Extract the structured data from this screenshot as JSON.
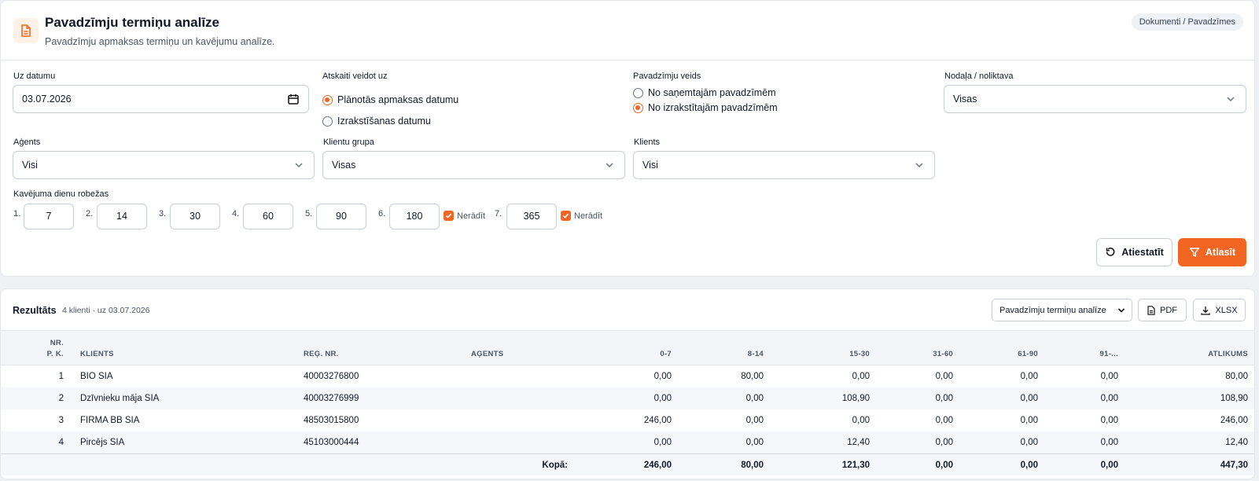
{
  "header": {
    "title": "Pavadzīmju termiņu analīze",
    "subtitle": "Pavadzīmju apmaksas termiņu un kavējumu analīze.",
    "breadcrumb": "Dokumenti / Pavadzīmes"
  },
  "filters": {
    "date_label": "Uz datumu",
    "date_value": "03.07.2026",
    "report_basis_label": "Atskaiti veidot uz",
    "report_basis_options": [
      "Plānotās apmaksas datumu",
      "Izrakstīšanas datumu"
    ],
    "report_basis_selected": 0,
    "invoice_type_label": "Pavadzīmju veids",
    "invoice_type_options": [
      "No saņemtajām pavadzīmēm",
      "No izrakstītajām pavadzīmēm"
    ],
    "invoice_type_selected": 1,
    "department_label": "Nodaļa / noliktava",
    "department_value": "Visas",
    "agent_label": "Aģents",
    "agent_value": "Visi",
    "client_group_label": "Klientu grupa",
    "client_group_value": "Visas",
    "client_label": "Klients",
    "client_value": "Visi",
    "thresholds_label": "Kavējuma dienu robežas",
    "thresholds": [
      {
        "num": "1.",
        "value": "7"
      },
      {
        "num": "2.",
        "value": "14"
      },
      {
        "num": "3.",
        "value": "30"
      },
      {
        "num": "4.",
        "value": "60"
      },
      {
        "num": "5.",
        "value": "90"
      },
      {
        "num": "6.",
        "value": "180",
        "hide_label": "Nerādīt",
        "hidden": true
      },
      {
        "num": "7.",
        "value": "365",
        "hide_label": "Nerādīt",
        "hidden": true
      }
    ],
    "reset_label": "Atiestatīt",
    "apply_label": "Atlasīt"
  },
  "results": {
    "title": "Rezultāts",
    "meta": "4 klienti · uz 03.07.2026",
    "report_select": "Pavadzīmju termiņu analīze",
    "pdf_label": "PDF",
    "xlsx_label": "XLSX",
    "columns": {
      "nr_line1": "NR.",
      "nr_line2": "P. K.",
      "client": "KLIENTS",
      "reg": "REĢ. NR.",
      "agent": "AĢENTS",
      "b1": "0-7",
      "b2": "8-14",
      "b3": "15-30",
      "b4": "31-60",
      "b5": "61-90",
      "b6": "91-...",
      "balance": "ATLIKUMS"
    },
    "rows": [
      {
        "nr": "1",
        "client": "BIO SIA",
        "reg": "40003276800",
        "agent": "",
        "b1": "0,00",
        "b2": "80,00",
        "b3": "0,00",
        "b4": "0,00",
        "b5": "0,00",
        "b6": "0,00",
        "balance": "80,00"
      },
      {
        "nr": "2",
        "client": "Dzīvnieku māja SIA",
        "reg": "40003276999",
        "agent": "",
        "b1": "0,00",
        "b2": "0,00",
        "b3": "108,90",
        "b4": "0,00",
        "b5": "0,00",
        "b6": "0,00",
        "balance": "108,90"
      },
      {
        "nr": "3",
        "client": "FIRMA BB SIA",
        "reg": "48503015800",
        "agent": "",
        "b1": "246,00",
        "b2": "0,00",
        "b3": "0,00",
        "b4": "0,00",
        "b5": "0,00",
        "b6": "0,00",
        "balance": "246,00"
      },
      {
        "nr": "4",
        "client": "Pircējs SIA",
        "reg": "45103000444",
        "agent": "",
        "b1": "0,00",
        "b2": "0,00",
        "b3": "12,40",
        "b4": "0,00",
        "b5": "0,00",
        "b6": "0,00",
        "balance": "12,40"
      }
    ],
    "totals": {
      "label": "Kopā:",
      "b1": "246,00",
      "b2": "80,00",
      "b3": "121,30",
      "b4": "0,00",
      "b5": "0,00",
      "b6": "0,00",
      "balance": "447,30"
    }
  },
  "colors": {
    "accent": "#f26522",
    "header_icon_bg": "#fff1e6",
    "table_header_bg": "#f3f5f8"
  }
}
